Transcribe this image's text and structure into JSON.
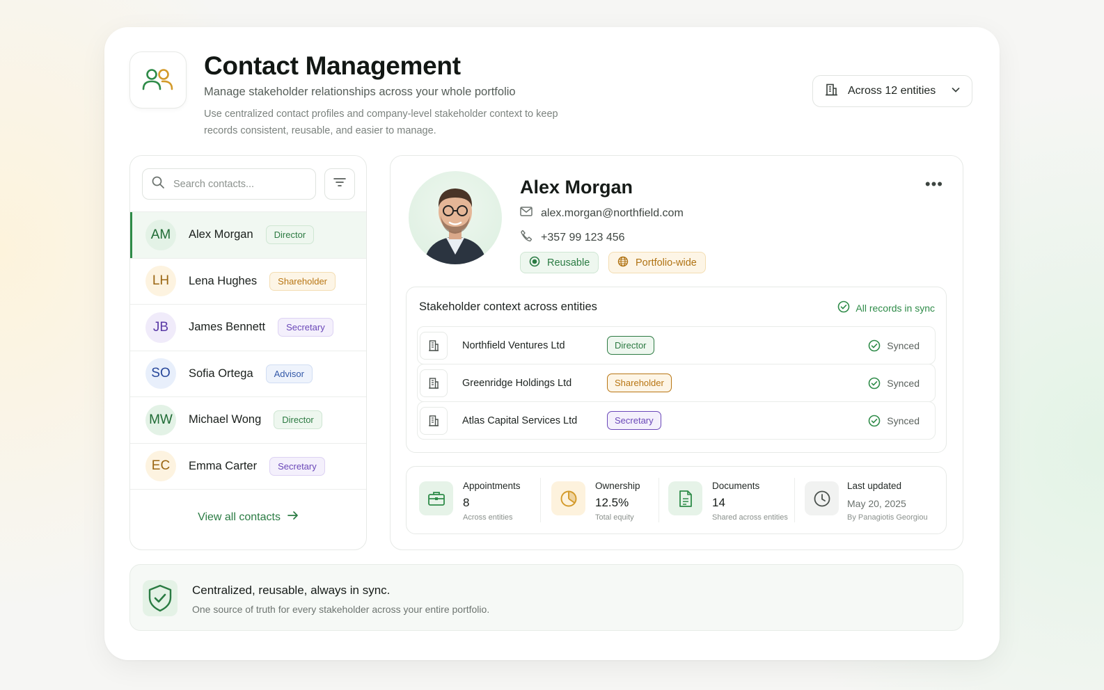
{
  "header": {
    "title": "Contact Management",
    "subtitle": "Manage stakeholder relationships across your whole portfolio",
    "description": "Use centralized contact profiles and company-level stakeholder context to keep records consistent, reusable, and easier to manage.",
    "entity_selector": "Across 12 entities"
  },
  "search": {
    "placeholder": "Search contacts..."
  },
  "contacts": [
    {
      "initials": "AM",
      "name": "Alex Morgan",
      "role": "Director",
      "active": true
    },
    {
      "initials": "LH",
      "name": "Lena Hughes",
      "role": "Shareholder"
    },
    {
      "initials": "JB",
      "name": "James Bennett",
      "role": "Secretary"
    },
    {
      "initials": "SO",
      "name": "Sofia Ortega",
      "role": "Advisor"
    },
    {
      "initials": "MW",
      "name": "Michael Wong",
      "role": "Director"
    },
    {
      "initials": "EC",
      "name": "Emma Carter",
      "role": "Secretary"
    }
  ],
  "view_all": "View all contacts",
  "profile": {
    "name": "Alex Morgan",
    "email": "alex.morgan@northfield.com",
    "phone": "+357 99 123 456",
    "tags": [
      "Reusable",
      "Portfolio-wide"
    ]
  },
  "stakeholder": {
    "title": "Stakeholder context across entities",
    "sync_status": "All records in sync",
    "entities": [
      {
        "name": "Northfield Ventures Ltd",
        "role": "Director",
        "status": "Synced"
      },
      {
        "name": "Greenridge Holdings Ltd",
        "role": "Shareholder",
        "status": "Synced"
      },
      {
        "name": "Atlas Capital Services Ltd",
        "role": "Secretary",
        "status": "Synced"
      }
    ]
  },
  "stats": [
    {
      "label": "Appointments",
      "value": "8",
      "sub": "Across entities",
      "icon": "briefcase-icon"
    },
    {
      "label": "Ownership",
      "value": "12.5%",
      "sub": "Total equity",
      "icon": "pie-chart-icon"
    },
    {
      "label": "Documents",
      "value": "14",
      "sub": "Shared across entities",
      "icon": "document-icon"
    },
    {
      "label": "Last updated",
      "value": "May 20, 2025",
      "sub": "By Panagiotis Georgiou",
      "icon": "clock-icon"
    }
  ],
  "banner": {
    "title": "Centralized, reusable, always in sync.",
    "text": "One source of truth for every stakeholder across your entire portfolio."
  },
  "colors": {
    "accent_green": "#2e8b48",
    "shareholder_amber": "#b87512",
    "secretary_purple": "#6a47b8",
    "advisor_blue": "#3358a8"
  }
}
